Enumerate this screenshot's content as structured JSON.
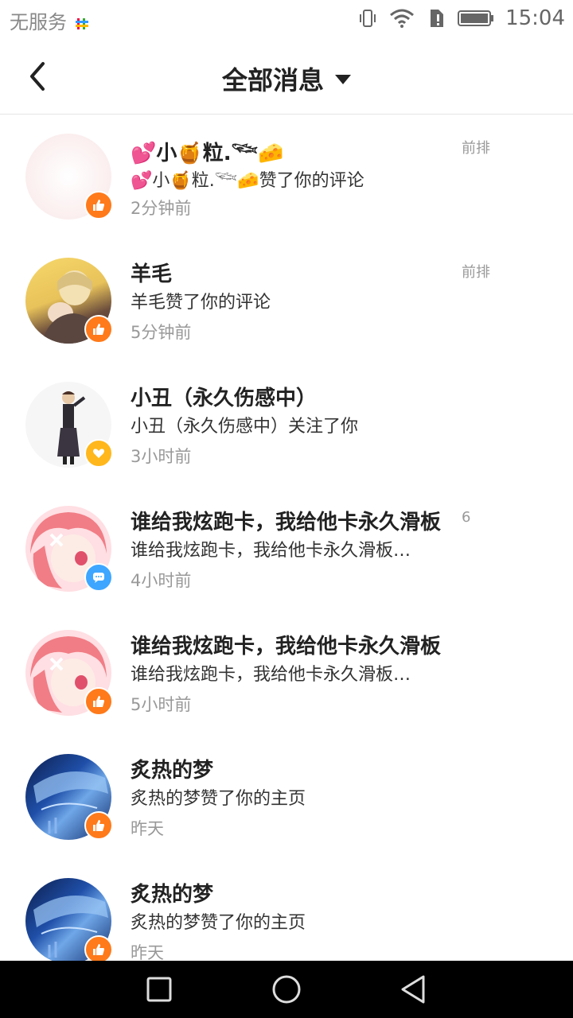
{
  "status": {
    "carrier": "无服务",
    "time": "15:04"
  },
  "header": {
    "title": "全部消息"
  },
  "messages": [
    {
      "name": "💕小🍯粒.𓆝🧀",
      "desc": "💕小🍯粒.𓆝🧀赞了你的评论",
      "time": "2分钟前",
      "tag": "前排",
      "badge": "like"
    },
    {
      "name": "羊毛",
      "desc": "羊毛赞了你的评论",
      "time": "5分钟前",
      "tag": "前排",
      "badge": "like"
    },
    {
      "name": "小丑（永久伤感中）",
      "desc": "小丑（永久伤感中）关注了你",
      "time": "3小时前",
      "tag": "",
      "badge": "follow"
    },
    {
      "name": "谁给我炫跑卡，我给他卡永久滑板",
      "desc": "谁给我炫跑卡，我给他卡永久滑板…",
      "time": "4小时前",
      "tag": "6",
      "badge": "comment"
    },
    {
      "name": "谁给我炫跑卡，我给他卡永久滑板",
      "desc": "谁给我炫跑卡，我给他卡永久滑板…",
      "time": "5小时前",
      "tag": "",
      "badge": "like"
    },
    {
      "name": "炙热的梦",
      "desc": "炙热的梦赞了你的主页",
      "time": "昨天",
      "tag": "",
      "badge": "like"
    },
    {
      "name": "炙热的梦",
      "desc": "炙热的梦赞了你的主页",
      "time": "昨天",
      "tag": "",
      "badge": "like"
    }
  ],
  "colors": {
    "like": "#ff7a1a",
    "follow": "#ffb71b",
    "comment": "#3ea6ff"
  }
}
